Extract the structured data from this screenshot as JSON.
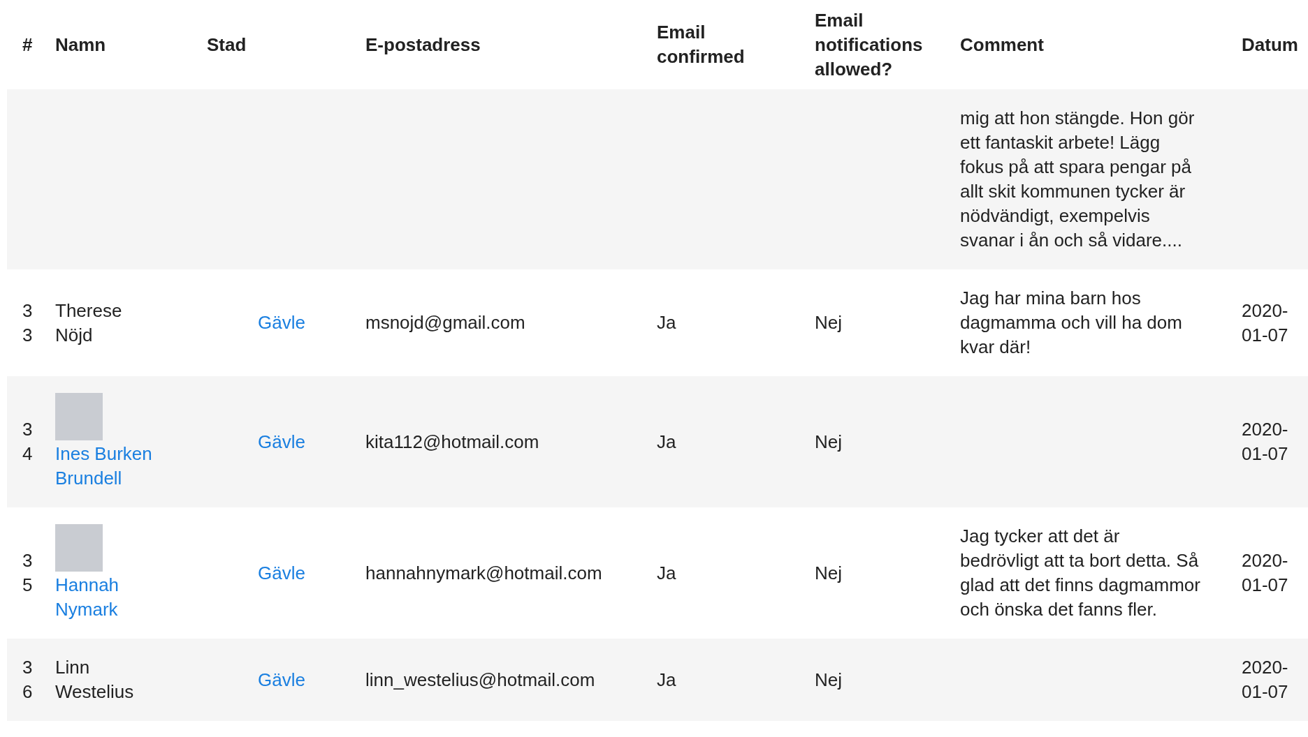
{
  "table": {
    "columns": [
      "#",
      "Namn",
      "Stad",
      "E-postadress",
      "Email confirmed",
      "Email notifications allowed?",
      "Comment",
      "Datum"
    ],
    "rows": [
      {
        "number": "",
        "city": "",
        "email": "",
        "confirmed": "",
        "notifications": "",
        "comment": "mig att hon stängde. Hon gör ett fantaskit arbete! Lägg fokus på att spara pengar på allt skit kommunen tycker är nödvändigt, exempelvis svanar i ån och så vidare....",
        "date": ""
      },
      {
        "number": "33",
        "name": "Therese Nöjd",
        "avatar": false,
        "linked": false,
        "city": "Gävle",
        "email": "msnojd@gmail.com",
        "confirmed": "Ja",
        "notifications": "Nej",
        "comment": "Jag har mina barn hos dagmamma och vill ha dom kvar där!",
        "date": "2020-01-07"
      },
      {
        "number": "34",
        "name": "Ines Burken Brundell",
        "avatar": true,
        "linked": true,
        "city": "Gävle",
        "email": "kita112@hotmail.com",
        "confirmed": "Ja",
        "notifications": "Nej",
        "comment": "",
        "date": "2020-01-07"
      },
      {
        "number": "35",
        "name": "Hannah Nymark",
        "avatar": true,
        "linked": true,
        "city": "Gävle",
        "email": "hannahnymark@hotmail.com",
        "confirmed": "Ja",
        "notifications": "Nej",
        "comment": "Jag tycker att det är bedrövligt att ta bort detta. Så glad att det finns dagmammor och önska det fanns fler.",
        "date": "2020-01-07"
      },
      {
        "number": "36",
        "name": "Linn Westelius",
        "avatar": false,
        "linked": false,
        "city": "Gävle",
        "email": "linn_westelius@hotmail.com",
        "confirmed": "Ja",
        "notifications": "Nej",
        "comment": "",
        "date": "2020-01-07"
      }
    ]
  }
}
